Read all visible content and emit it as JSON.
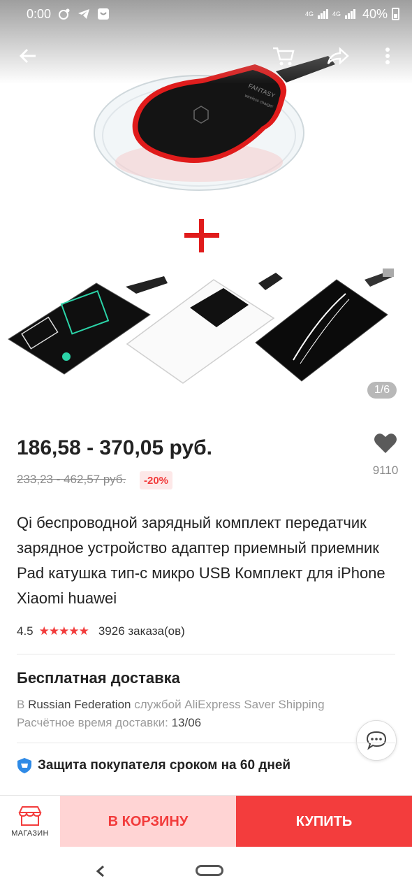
{
  "status_bar": {
    "time": "0:00",
    "network_1": "4G",
    "network_2": "4G",
    "battery": "40%"
  },
  "gallery": {
    "page_counter": "1/6",
    "product_images": [
      "wireless-charger-pad",
      "plus-sign",
      "receiver-adapters"
    ]
  },
  "toolbar": {
    "back_icon": "arrow-left-icon",
    "cart_icon": "cart-icon",
    "share_icon": "share-icon",
    "more_icon": "more-vertical-icon"
  },
  "product": {
    "price": "186,58 - 370,05 руб.",
    "old_price": "233,23 - 462,57 руб.",
    "discount": "-20%",
    "favorites_count": "9110",
    "title": "Qi беспроводной зарядный комплект передатчик зарядное устройство адаптер приемный приемник Pad катушка тип-с микро USB Комплект для iPhone Xiaomi huawei",
    "rating": "4.5",
    "stars": "★★★★★",
    "orders": "3926 заказа(ов)"
  },
  "shipping": {
    "title": "Бесплатная доставка",
    "line1_prefix": "В ",
    "line1_country": "Russian Federation",
    "line1_suffix": " службой AliExpress Saver Shipping",
    "line2_prefix": "Расчётное время доставки: ",
    "line2_date": "13/06"
  },
  "protection": {
    "text": "Защита покупателя сроком на 60 дней"
  },
  "actions": {
    "shop_label": "МАГАЗИН",
    "add_to_cart": "В КОРЗИНУ",
    "buy": "КУПИТЬ"
  },
  "colors": {
    "accent": "#f33d3d",
    "cart_bg": "#ffd4d4",
    "protect_blue": "#2e8ae6"
  }
}
